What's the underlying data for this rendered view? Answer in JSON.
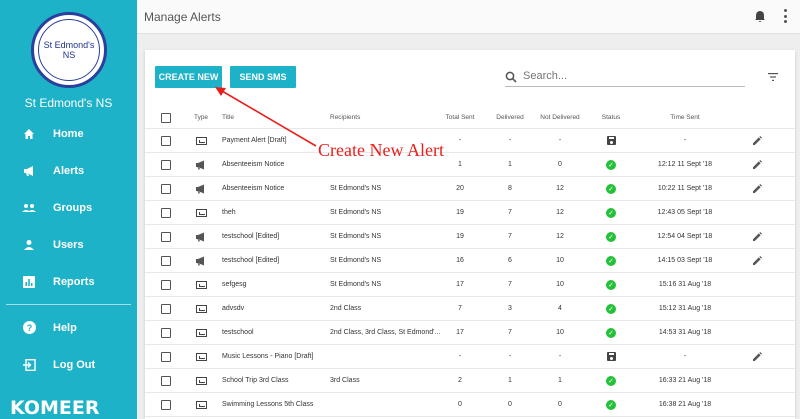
{
  "sidebar": {
    "logo_text": "St Edmond's NS",
    "school_name": "St Edmond's NS",
    "items": [
      {
        "label": "Home",
        "icon": "home-icon"
      },
      {
        "label": "Alerts",
        "icon": "megaphone-icon"
      },
      {
        "label": "Groups",
        "icon": "groups-icon"
      },
      {
        "label": "Users",
        "icon": "user-icon"
      },
      {
        "label": "Reports",
        "icon": "reports-icon"
      },
      {
        "label": "Help",
        "icon": "help-icon"
      },
      {
        "label": "Log Out",
        "icon": "logout-icon"
      }
    ],
    "brand": "KOMEER"
  },
  "topbar": {
    "title": "Manage Alerts"
  },
  "toolbar": {
    "create_label": "CREATE NEW",
    "sms_label": "SEND SMS",
    "search_placeholder": "Search..."
  },
  "annotation": {
    "text": "Create New Alert",
    "color": "#e8201c"
  },
  "table": {
    "headers": {
      "type": "Type",
      "title": "Title",
      "recipients": "Recipients",
      "sent": "Total Sent",
      "delivered": "Delivered",
      "not_delivered": "Not Delivered",
      "status": "Status",
      "time": "Time Sent"
    },
    "rows": [
      {
        "type": "sms",
        "title": "Payment Alert [Draft]",
        "recipients": "",
        "sent": "-",
        "delivered": "-",
        "nd": "-",
        "status": "draft",
        "time": "-",
        "edit": true
      },
      {
        "type": "alert",
        "title": "Absenteeism Notice",
        "recipients": "",
        "sent": "1",
        "delivered": "1",
        "nd": "0",
        "status": "sent",
        "time": "12:12 11 Sept '18",
        "edit": true
      },
      {
        "type": "alert",
        "title": "Absenteeism Notice",
        "recipients": "St Edmond's NS",
        "sent": "20",
        "delivered": "8",
        "nd": "12",
        "status": "sent",
        "time": "10:22 11 Sept '18",
        "edit": true
      },
      {
        "type": "sms",
        "title": "theh",
        "recipients": "St Edmond's NS",
        "sent": "19",
        "delivered": "7",
        "nd": "12",
        "status": "sent",
        "time": "12:43 05 Sept '18",
        "edit": false
      },
      {
        "type": "alert",
        "title": "testschool [Edited]",
        "recipients": "St Edmond's NS",
        "sent": "19",
        "delivered": "7",
        "nd": "12",
        "status": "sent",
        "time": "12:54 04 Sept '18",
        "edit": true
      },
      {
        "type": "alert",
        "title": "testschool [Edited]",
        "recipients": "St Edmond's NS",
        "sent": "16",
        "delivered": "6",
        "nd": "10",
        "status": "sent",
        "time": "14:15 03 Sept '18",
        "edit": true
      },
      {
        "type": "sms",
        "title": "sefgesg",
        "recipients": "St Edmond's NS",
        "sent": "17",
        "delivered": "7",
        "nd": "10",
        "status": "sent",
        "time": "15:16 31 Aug '18",
        "edit": false
      },
      {
        "type": "sms",
        "title": "advsdv",
        "recipients": "2nd Class",
        "sent": "7",
        "delivered": "3",
        "nd": "4",
        "status": "sent",
        "time": "15:12 31 Aug '18",
        "edit": false
      },
      {
        "type": "sms",
        "title": "testschool",
        "recipients": "2nd Class, 3rd Class, St Edmond'...",
        "sent": "17",
        "delivered": "7",
        "nd": "10",
        "status": "sent",
        "time": "14:53 31 Aug '18",
        "edit": false
      },
      {
        "type": "sms",
        "title": "Music Lessons - Piano [Draft]",
        "recipients": "",
        "sent": "-",
        "delivered": "-",
        "nd": "-",
        "status": "draft",
        "time": "-",
        "edit": true
      },
      {
        "type": "sms",
        "title": "School Trip 3rd Class",
        "recipients": "3rd Class",
        "sent": "2",
        "delivered": "1",
        "nd": "1",
        "status": "sent",
        "time": "16:33 21 Aug '18",
        "edit": false
      },
      {
        "type": "sms",
        "title": "Swimming Lessons 5th Class",
        "recipients": "",
        "sent": "0",
        "delivered": "0",
        "nd": "0",
        "status": "sent",
        "time": "16:38 21 Aug '18",
        "edit": false
      }
    ]
  }
}
